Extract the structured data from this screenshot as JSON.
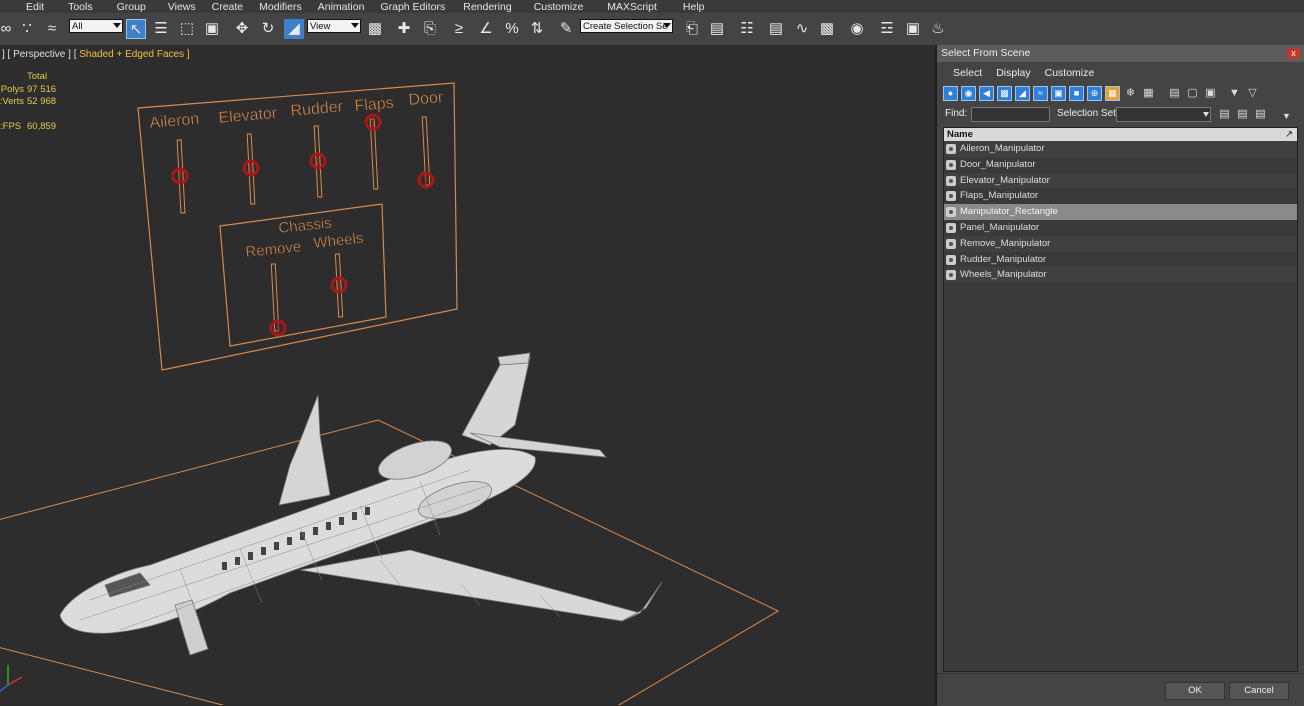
{
  "menubar": [
    "Edit",
    "Tools",
    "Group",
    "Views",
    "Create",
    "Modifiers",
    "Animation",
    "Graph Editors",
    "Rendering",
    "Customize",
    "MAXScript",
    "Help"
  ],
  "toolbar": {
    "filter_value": "All",
    "coord_value": "View",
    "selection_set_value": "Create Selection Se"
  },
  "viewport": {
    "label_left": "] [ Perspective ] [",
    "label_right": "Shaded + Edged Faces ]",
    "stats": {
      "header": "Total",
      "polys_label": "Polys:",
      "polys_value": "97 516",
      "verts_label": "Verts:",
      "verts_value": "52 968",
      "fps_label": "FPS:",
      "fps_value": "60,859"
    },
    "panel": {
      "labels": [
        "Aileron",
        "Elevator",
        "Rudder",
        "Flaps",
        "Door"
      ],
      "chassis_title": "Chassis",
      "chassis_labels": [
        "Remove",
        "Wheels"
      ]
    }
  },
  "dialog": {
    "title": "Select From Scene",
    "close_label": "x",
    "menu": [
      "Select",
      "Display",
      "Customize"
    ],
    "find_label": "Find:",
    "find_value": "",
    "selection_set_label": "Selection Set:",
    "column_name": "Name",
    "items": [
      "Aileron_Manipulator",
      "Door_Manipulator",
      "Elevator_Manipulator",
      "Flaps_Manipulator",
      "Manipulator_Rectangle",
      "Panel_Manipulator",
      "Remove_Manipulator",
      "Rudder_Manipulator",
      "Wheels_Manipulator"
    ],
    "selected_item": "Manipulator_Rectangle",
    "ok_label": "OK",
    "cancel_label": "Cancel"
  },
  "colors": {
    "manipulator": "#d98a4a",
    "handle": "#a81818",
    "selection": "#8a8a8a",
    "stats_text": "#e8c94a"
  }
}
